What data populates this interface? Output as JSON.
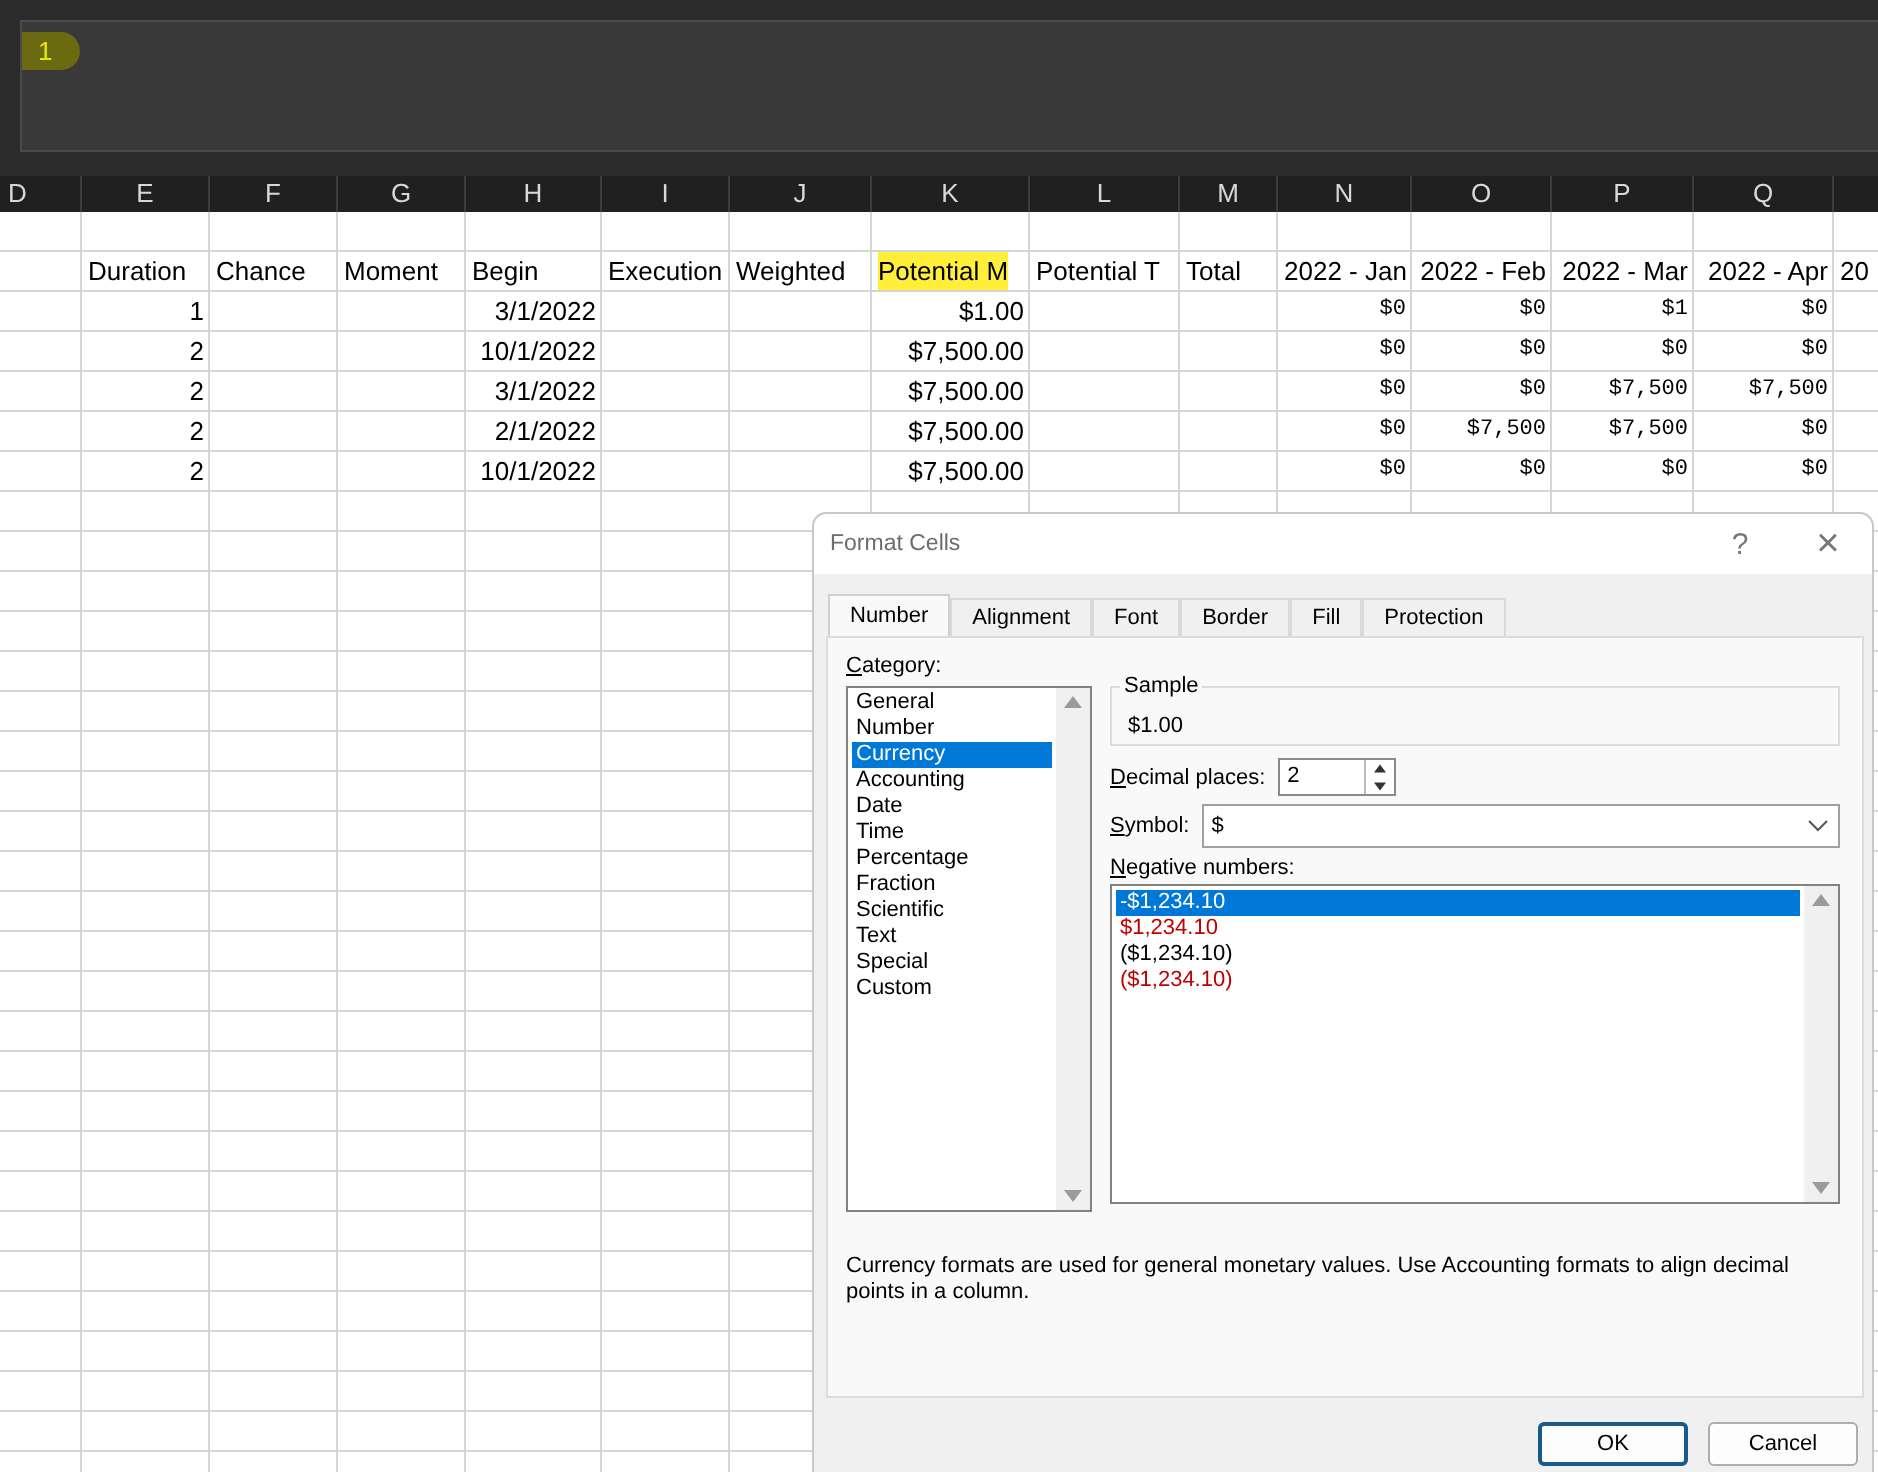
{
  "formula_bar": {
    "value": "1",
    "highlighted": true
  },
  "columns": [
    {
      "letter": "D"
    },
    {
      "letter": "E",
      "kind": "number",
      "title": "Duration",
      "highlighted": false
    },
    {
      "letter": "F",
      "kind": "text",
      "title": "Chance",
      "highlighted": false
    },
    {
      "letter": "G",
      "kind": "text",
      "title": "Moment",
      "highlighted": false
    },
    {
      "letter": "H",
      "kind": "number",
      "title": "Begin",
      "highlighted": false
    },
    {
      "letter": "I",
      "kind": "text",
      "title": "Execution",
      "highlighted": false
    },
    {
      "letter": "J",
      "kind": "text",
      "title": "Weighted",
      "highlighted": false
    },
    {
      "letter": "K",
      "kind": "number",
      "title": "Potential M",
      "highlighted": true
    },
    {
      "letter": "L",
      "kind": "text",
      "title": "Potential T",
      "highlighted": false
    },
    {
      "letter": "M",
      "kind": "text",
      "title": "Total",
      "highlighted": false
    },
    {
      "letter": "N",
      "kind": "mono",
      "title": "2022 - Jan",
      "highlighted": false
    },
    {
      "letter": "O",
      "kind": "mono",
      "title": "2022 - Feb",
      "highlighted": false
    },
    {
      "letter": "P",
      "kind": "mono",
      "title": "2022 - Mar",
      "highlighted": false
    },
    {
      "letter": "Q",
      "kind": "mono",
      "title": "2022 - Apr",
      "highlighted": false
    },
    {
      "kind": "text",
      "title": "20",
      "highlighted": false
    }
  ],
  "rows": [
    {
      "cells": {
        "E": "1",
        "H": "3/1/2022",
        "K": "$1.00",
        "N": "$0",
        "O": "$0",
        "P": "$1",
        "Q": "$0"
      }
    },
    {
      "cells": {
        "E": "2",
        "H": "10/1/2022",
        "K": "$7,500.00",
        "N": "$0",
        "O": "$0",
        "P": "$0",
        "Q": "$0"
      }
    },
    {
      "cells": {
        "E": "2",
        "H": "3/1/2022",
        "K": "$7,500.00",
        "N": "$0",
        "O": "$0",
        "P": "$7,500",
        "Q": "$7,500"
      }
    },
    {
      "cells": {
        "E": "2",
        "H": "2/1/2022",
        "K": "$7,500.00",
        "N": "$0",
        "O": "$7,500",
        "P": "$7,500",
        "Q": "$0"
      }
    },
    {
      "cells": {
        "E": "2",
        "H": "10/1/2022",
        "K": "$7,500.00",
        "N": "$0",
        "O": "$0",
        "P": "$0",
        "Q": "$0"
      }
    }
  ],
  "dialog": {
    "title": "Format Cells",
    "help": "?",
    "close": "×",
    "tabs": [
      {
        "label": "Number",
        "selected": true
      },
      {
        "label": "Alignment",
        "selected": false
      },
      {
        "label": "Font",
        "selected": false
      },
      {
        "label": "Border",
        "selected": false
      },
      {
        "label": "Fill",
        "selected": false
      },
      {
        "label": "Protection",
        "selected": false
      }
    ],
    "category_label": "Category:",
    "categories": [
      {
        "label": "General",
        "selected": false
      },
      {
        "label": "Number",
        "selected": false
      },
      {
        "label": "Currency",
        "selected": true
      },
      {
        "label": "Accounting",
        "selected": false
      },
      {
        "label": "Date",
        "selected": false
      },
      {
        "label": "Time",
        "selected": false
      },
      {
        "label": "Percentage",
        "selected": false
      },
      {
        "label": "Fraction",
        "selected": false
      },
      {
        "label": "Scientific",
        "selected": false
      },
      {
        "label": "Text",
        "selected": false
      },
      {
        "label": "Special",
        "selected": false
      },
      {
        "label": "Custom",
        "selected": false
      }
    ],
    "sample": {
      "label": "Sample",
      "value": "$1.00"
    },
    "decimal_places": {
      "label": "Decimal places:",
      "value": "2"
    },
    "symbol": {
      "label": "Symbol:",
      "value": "$"
    },
    "negative_label": "Negative numbers:",
    "negative_numbers": [
      {
        "text": "-$1,234.10",
        "selected": true
      },
      {
        "text": "$1,234.10",
        "color": "#c00000",
        "selected": false
      },
      {
        "text": "($1,234.10)",
        "color": "#000000",
        "selected": false
      },
      {
        "text": "($1,234.10)",
        "color": "#c00000",
        "selected": false
      }
    ],
    "description": "Currency formats are used for general monetary values.  Use Accounting formats to align decimal points in a column.",
    "buttons": [
      {
        "label": "OK",
        "kind": "default"
      },
      {
        "label": "Cancel",
        "kind": "normal"
      }
    ]
  }
}
